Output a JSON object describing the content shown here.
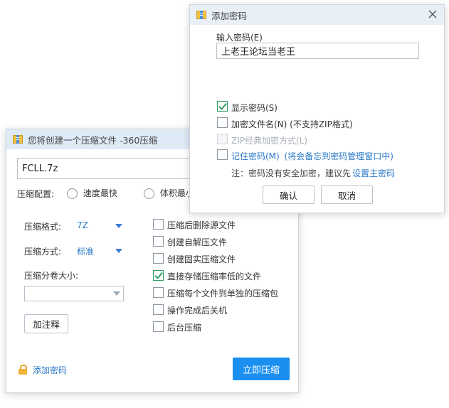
{
  "main": {
    "title": "您将创建一个压缩文件 -360压缩",
    "filename": "FCLL.7z",
    "config_label": "压缩配置:",
    "radio_fast": "速度最快",
    "radio_small": "体积最小",
    "format_label": "压缩格式:",
    "format_value": "7Z",
    "method_label": "压缩方式:",
    "method_value": "标准",
    "split_label": "压缩分卷大小:",
    "split_value": "",
    "comment_button": "加注释",
    "add_password_link": "添加密码",
    "compress_button": "立即压缩",
    "options": [
      {
        "label": "压缩后删除源文件",
        "checked": false
      },
      {
        "label": "创建自解压文件",
        "checked": false
      },
      {
        "label": "创建固实压缩文件",
        "checked": false
      },
      {
        "label": "直接存储压缩率低的文件",
        "checked": true
      },
      {
        "label": "压缩每个文件到单独的压缩包",
        "checked": false
      },
      {
        "label": "操作完成后关机",
        "checked": false
      },
      {
        "label": "后台压缩",
        "checked": false
      }
    ]
  },
  "dialog": {
    "title": "添加密码",
    "enter_label": "输入密码(E)",
    "password_value": "上老王论坛当老王",
    "show_password": "显示密码(S)",
    "encrypt_names": "加密文件名(N) (不支持ZIP格式)",
    "zip_classic": "ZIP经典加密方式(L)",
    "remember": "记住密码(M)",
    "remember_hint": "(将会备忘到密码管理窗口中)",
    "note": "注：密码没有安全加密，建议先",
    "set_master": "设置主密码",
    "ok": "确认",
    "cancel": "取消"
  }
}
